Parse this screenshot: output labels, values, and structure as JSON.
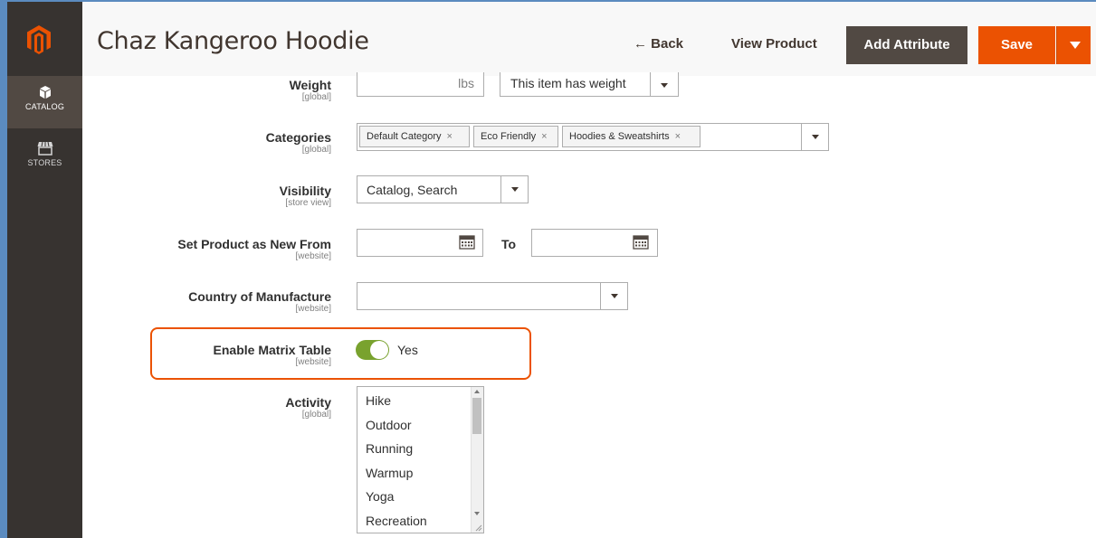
{
  "sidebar": {
    "items": [
      {
        "label": "CATALOG",
        "icon": "box-icon"
      },
      {
        "label": "STORES",
        "icon": "storefront-icon"
      }
    ]
  },
  "header": {
    "title": "Chaz Kangeroo Hoodie",
    "back_label": "← Back",
    "view_label": "View Product",
    "add_label": "Add Attribute",
    "save_label": "Save"
  },
  "form": {
    "weight": {
      "label": "Weight",
      "scope": "[global]",
      "unit": "lbs",
      "select_value": "This item has weight"
    },
    "categories": {
      "label": "Categories",
      "scope": "[global]",
      "chips": [
        "Default Category",
        "Eco Friendly",
        "Hoodies & Sweatshirts"
      ]
    },
    "visibility": {
      "label": "Visibility",
      "scope": "[store view]",
      "value": "Catalog, Search"
    },
    "new_from": {
      "label": "Set Product as New From",
      "scope": "[website]",
      "to_label": "To"
    },
    "country": {
      "label": "Country of Manufacture",
      "scope": "[website]"
    },
    "matrix": {
      "label": "Enable Matrix Table",
      "scope": "[website]",
      "value": "Yes"
    },
    "activity": {
      "label": "Activity",
      "scope": "[global]",
      "options": [
        "Hike",
        "Outdoor",
        "Running",
        "Warmup",
        "Yoga",
        "Recreation"
      ]
    }
  },
  "colors": {
    "accent": "#eb5202",
    "sidebar": "#373330",
    "toggle_on": "#79a22e"
  }
}
